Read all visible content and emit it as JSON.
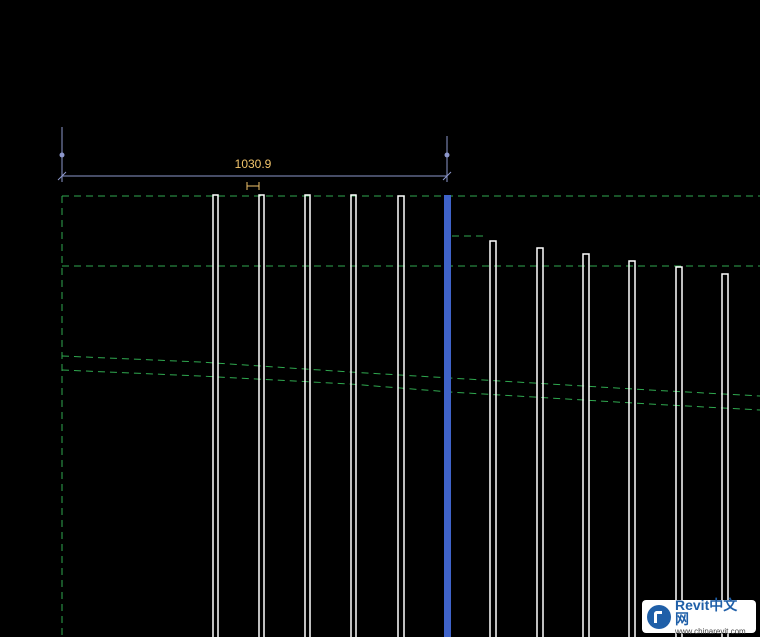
{
  "dimension": {
    "value": "1030.9",
    "color": "#f2c46b"
  },
  "colors": {
    "background": "#000000",
    "reference_line": "#2fa84f",
    "dimension_line": "#8d97cc",
    "selected_element": "#3f63c9",
    "element_outline": "#ffffff"
  },
  "watermark": {
    "title": "Revit中文网",
    "url": "www.chinarevit.com"
  }
}
